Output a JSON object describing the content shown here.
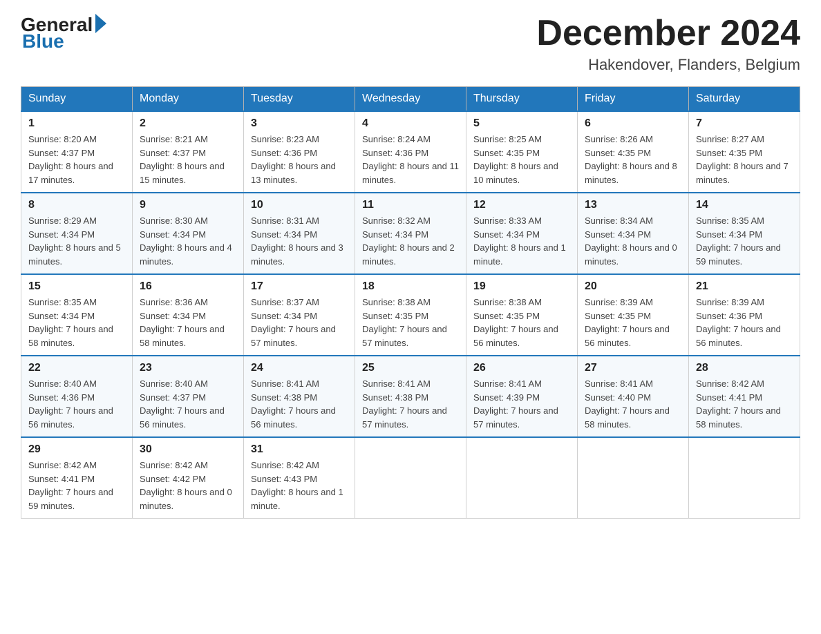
{
  "header": {
    "logo_general": "General",
    "logo_blue": "Blue",
    "month_title": "December 2024",
    "subtitle": "Hakendover, Flanders, Belgium"
  },
  "days_of_week": [
    "Sunday",
    "Monday",
    "Tuesday",
    "Wednesday",
    "Thursday",
    "Friday",
    "Saturday"
  ],
  "weeks": [
    [
      {
        "day": "1",
        "sunrise": "8:20 AM",
        "sunset": "4:37 PM",
        "daylight": "8 hours and 17 minutes."
      },
      {
        "day": "2",
        "sunrise": "8:21 AM",
        "sunset": "4:37 PM",
        "daylight": "8 hours and 15 minutes."
      },
      {
        "day": "3",
        "sunrise": "8:23 AM",
        "sunset": "4:36 PM",
        "daylight": "8 hours and 13 minutes."
      },
      {
        "day": "4",
        "sunrise": "8:24 AM",
        "sunset": "4:36 PM",
        "daylight": "8 hours and 11 minutes."
      },
      {
        "day": "5",
        "sunrise": "8:25 AM",
        "sunset": "4:35 PM",
        "daylight": "8 hours and 10 minutes."
      },
      {
        "day": "6",
        "sunrise": "8:26 AM",
        "sunset": "4:35 PM",
        "daylight": "8 hours and 8 minutes."
      },
      {
        "day": "7",
        "sunrise": "8:27 AM",
        "sunset": "4:35 PM",
        "daylight": "8 hours and 7 minutes."
      }
    ],
    [
      {
        "day": "8",
        "sunrise": "8:29 AM",
        "sunset": "4:34 PM",
        "daylight": "8 hours and 5 minutes."
      },
      {
        "day": "9",
        "sunrise": "8:30 AM",
        "sunset": "4:34 PM",
        "daylight": "8 hours and 4 minutes."
      },
      {
        "day": "10",
        "sunrise": "8:31 AM",
        "sunset": "4:34 PM",
        "daylight": "8 hours and 3 minutes."
      },
      {
        "day": "11",
        "sunrise": "8:32 AM",
        "sunset": "4:34 PM",
        "daylight": "8 hours and 2 minutes."
      },
      {
        "day": "12",
        "sunrise": "8:33 AM",
        "sunset": "4:34 PM",
        "daylight": "8 hours and 1 minute."
      },
      {
        "day": "13",
        "sunrise": "8:34 AM",
        "sunset": "4:34 PM",
        "daylight": "8 hours and 0 minutes."
      },
      {
        "day": "14",
        "sunrise": "8:35 AM",
        "sunset": "4:34 PM",
        "daylight": "7 hours and 59 minutes."
      }
    ],
    [
      {
        "day": "15",
        "sunrise": "8:35 AM",
        "sunset": "4:34 PM",
        "daylight": "7 hours and 58 minutes."
      },
      {
        "day": "16",
        "sunrise": "8:36 AM",
        "sunset": "4:34 PM",
        "daylight": "7 hours and 58 minutes."
      },
      {
        "day": "17",
        "sunrise": "8:37 AM",
        "sunset": "4:34 PM",
        "daylight": "7 hours and 57 minutes."
      },
      {
        "day": "18",
        "sunrise": "8:38 AM",
        "sunset": "4:35 PM",
        "daylight": "7 hours and 57 minutes."
      },
      {
        "day": "19",
        "sunrise": "8:38 AM",
        "sunset": "4:35 PM",
        "daylight": "7 hours and 56 minutes."
      },
      {
        "day": "20",
        "sunrise": "8:39 AM",
        "sunset": "4:35 PM",
        "daylight": "7 hours and 56 minutes."
      },
      {
        "day": "21",
        "sunrise": "8:39 AM",
        "sunset": "4:36 PM",
        "daylight": "7 hours and 56 minutes."
      }
    ],
    [
      {
        "day": "22",
        "sunrise": "8:40 AM",
        "sunset": "4:36 PM",
        "daylight": "7 hours and 56 minutes."
      },
      {
        "day": "23",
        "sunrise": "8:40 AM",
        "sunset": "4:37 PM",
        "daylight": "7 hours and 56 minutes."
      },
      {
        "day": "24",
        "sunrise": "8:41 AM",
        "sunset": "4:38 PM",
        "daylight": "7 hours and 56 minutes."
      },
      {
        "day": "25",
        "sunrise": "8:41 AM",
        "sunset": "4:38 PM",
        "daylight": "7 hours and 57 minutes."
      },
      {
        "day": "26",
        "sunrise": "8:41 AM",
        "sunset": "4:39 PM",
        "daylight": "7 hours and 57 minutes."
      },
      {
        "day": "27",
        "sunrise": "8:41 AM",
        "sunset": "4:40 PM",
        "daylight": "7 hours and 58 minutes."
      },
      {
        "day": "28",
        "sunrise": "8:42 AM",
        "sunset": "4:41 PM",
        "daylight": "7 hours and 58 minutes."
      }
    ],
    [
      {
        "day": "29",
        "sunrise": "8:42 AM",
        "sunset": "4:41 PM",
        "daylight": "7 hours and 59 minutes."
      },
      {
        "day": "30",
        "sunrise": "8:42 AM",
        "sunset": "4:42 PM",
        "daylight": "8 hours and 0 minutes."
      },
      {
        "day": "31",
        "sunrise": "8:42 AM",
        "sunset": "4:43 PM",
        "daylight": "8 hours and 1 minute."
      },
      null,
      null,
      null,
      null
    ]
  ],
  "labels": {
    "sunrise_prefix": "Sunrise: ",
    "sunset_prefix": "Sunset: ",
    "daylight_prefix": "Daylight: "
  }
}
